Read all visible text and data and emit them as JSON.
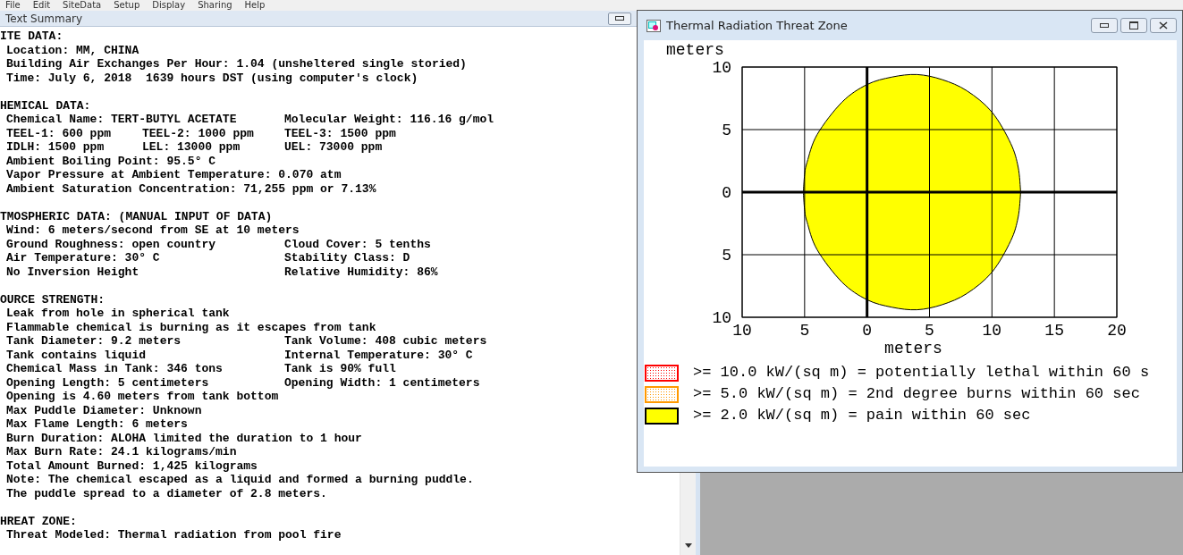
{
  "menu": [
    "File",
    "Edit",
    "SiteData",
    "Setup",
    "Display",
    "Sharing",
    "Help"
  ],
  "text_summary": {
    "title": "Text Summary",
    "sections": [
      {
        "heading": "ITE DATA:",
        "lines": [
          [
            "Location: MM, CHINA"
          ],
          [
            "Building Air Exchanges Per Hour: 1.04 (unsheltered single storied)"
          ],
          [
            "Time: July 6, 2018  1639 hours DST (using computer's clock)"
          ]
        ]
      },
      {
        "heading": "HEMICAL DATA:",
        "lines": [
          [
            "Chemical Name: TERT-BUTYL ACETATE",
            "Molecular Weight: 116.16 g/mol"
          ],
          [
            "TEEL-1: 600 ppm",
            "TEEL-2: 1000 ppm",
            "TEEL-3: 1500 ppm"
          ],
          [
            "IDLH: 1500 ppm",
            "LEL: 13000 ppm",
            "UEL: 73000 ppm"
          ],
          [
            "Ambient Boiling Point: 95.5° C"
          ],
          [
            "Vapor Pressure at Ambient Temperature: 0.070 atm"
          ],
          [
            "Ambient Saturation Concentration: 71,255 ppm or 7.13%"
          ]
        ]
      },
      {
        "heading": "TMOSPHERIC DATA: (MANUAL INPUT OF DATA)",
        "lines": [
          [
            "Wind: 6 meters/second from SE at 10 meters"
          ],
          [
            "Ground Roughness: open country",
            "Cloud Cover: 5 tenths"
          ],
          [
            "Air Temperature: 30° C",
            "Stability Class: D"
          ],
          [
            "No Inversion Height",
            "Relative Humidity: 86%"
          ]
        ]
      },
      {
        "heading": "OURCE STRENGTH:",
        "lines": [
          [
            "Leak from hole in spherical tank"
          ],
          [
            "Flammable chemical is burning as it escapes from tank"
          ],
          [
            "Tank Diameter: 9.2 meters",
            "Tank Volume: 408 cubic meters"
          ],
          [
            "Tank contains liquid",
            "Internal Temperature: 30° C"
          ],
          [
            "Chemical Mass in Tank: 346 tons",
            "Tank is 90% full"
          ],
          [
            "Opening Length: 5 centimeters",
            "Opening Width: 1 centimeters"
          ],
          [
            "Opening is 4.60 meters from tank bottom"
          ],
          [
            "Max Puddle Diameter: Unknown"
          ],
          [
            "Max Flame Length: 6 meters"
          ],
          [
            "Burn Duration: ALOHA limited the duration to 1 hour"
          ],
          [
            "Max Burn Rate: 24.1 kilograms/min"
          ],
          [
            "Total Amount Burned: 1,425 kilograms"
          ],
          [
            "Note: The chemical escaped as a liquid and formed a burning puddle."
          ],
          [
            "The puddle spread to a diameter of 2.8 meters."
          ]
        ]
      },
      {
        "heading": "HREAT ZONE:",
        "lines": [
          [
            "Threat Modeled: Thermal radiation from pool fire"
          ]
        ]
      }
    ]
  },
  "threat_window": {
    "title": "Thermal Radiation Threat Zone",
    "chart_data": {
      "type": "area",
      "xlabel": "meters",
      "ylabel": "meters",
      "xlim": [
        -10,
        20
      ],
      "ylim": [
        -10,
        10
      ],
      "xticks": [
        {
          "value": -10,
          "label": "10"
        },
        {
          "value": -5,
          "label": "5"
        },
        0,
        5,
        10,
        15,
        20
      ],
      "yticks": [
        {
          "value": -10,
          "label": "10"
        },
        {
          "value": -5,
          "label": "5"
        },
        0,
        5,
        10
      ],
      "grid": true,
      "x": [
        -5.1,
        -5,
        -4.8,
        -4,
        -2,
        0,
        2,
        4,
        6,
        8,
        10,
        11.5,
        12.1,
        12.3
      ],
      "series": [
        {
          "color": "#ffff00",
          "values": [
            0,
            1.4,
            2.4,
            4.6,
            7.2,
            8.6,
            9.2,
            9.4,
            9.0,
            8.1,
            6.4,
            3.9,
            2.0,
            0
          ]
        },
        {
          "color": "#ffff00",
          "values": [
            0,
            -1.4,
            -2.4,
            -4.6,
            -7.2,
            -8.6,
            -9.2,
            -9.4,
            -9.0,
            -8.1,
            -6.4,
            -3.9,
            -2.0,
            0
          ]
        }
      ]
    },
    "legend": [
      {
        "kind": "dotted",
        "color": "#ff0000",
        "label": ">= 10.0 kW/(sq m) = potentially lethal within 60 s"
      },
      {
        "kind": "dotted",
        "color": "#ff9900",
        "label": ">= 5.0 kW/(sq m) = 2nd degree burns within 60 sec"
      },
      {
        "kind": "solid",
        "color": "#ffff00",
        "label": ">= 2.0 kW/(sq m) = pain within 60 sec"
      }
    ]
  }
}
